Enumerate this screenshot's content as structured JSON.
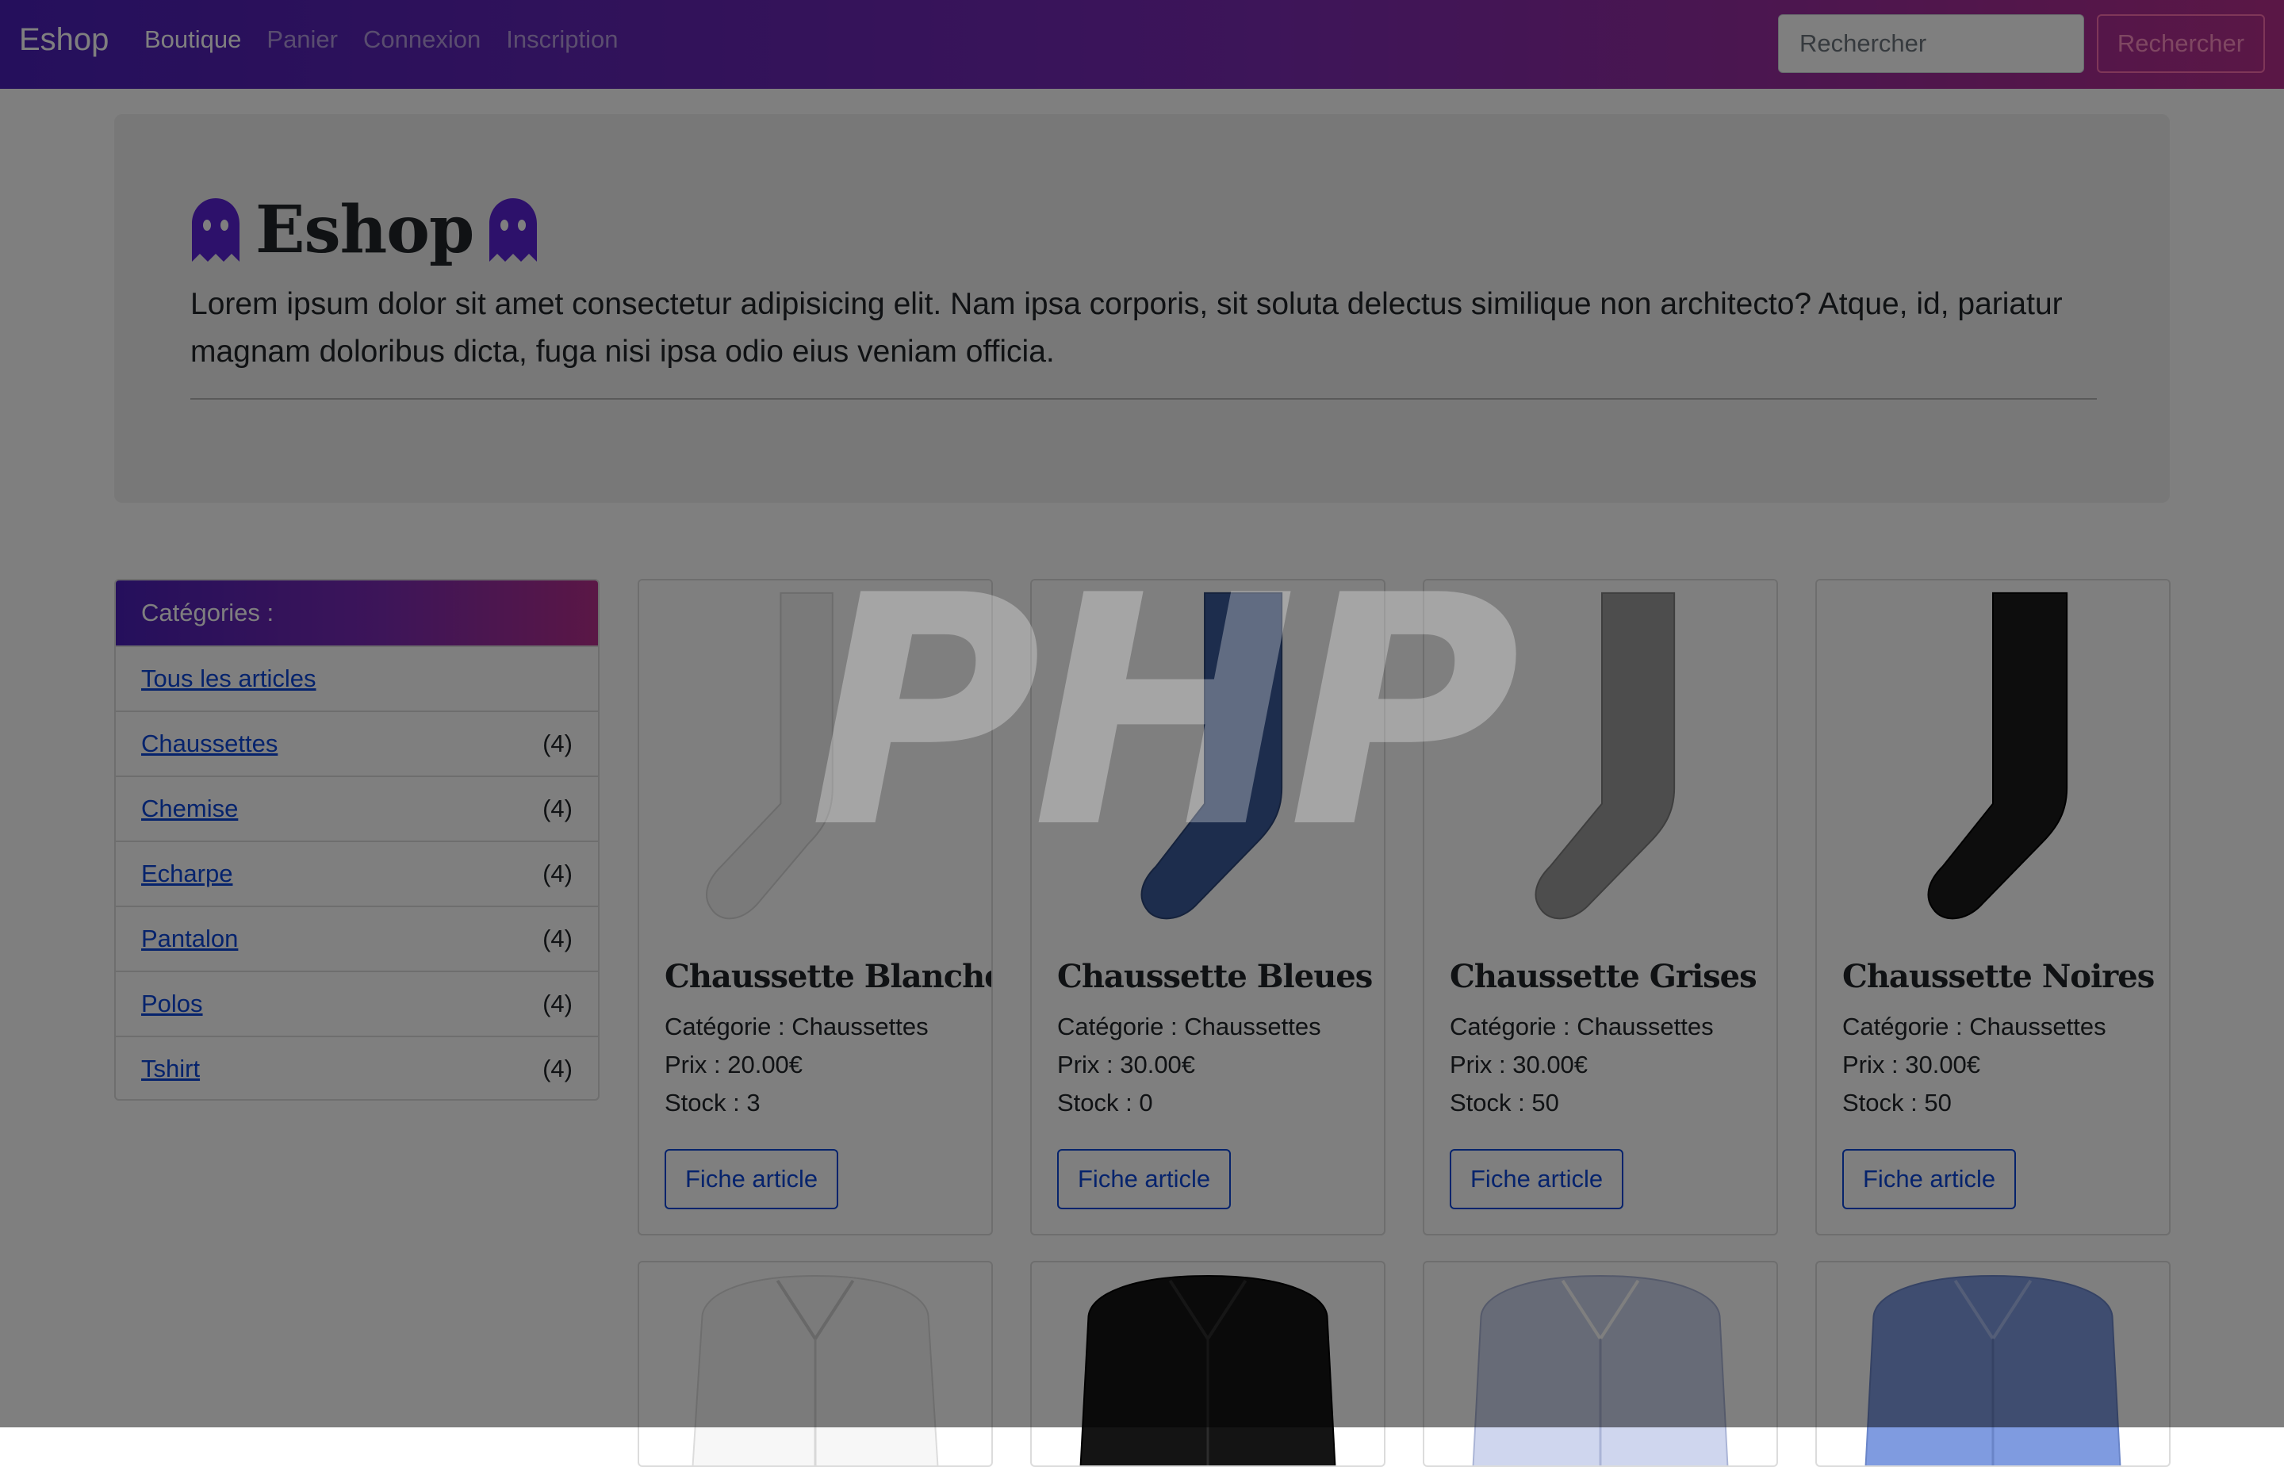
{
  "navbar": {
    "brand": "Eshop",
    "links": [
      "Boutique",
      "Panier",
      "Connexion",
      "Inscription"
    ],
    "search_placeholder": "Rechercher",
    "search_button": "Rechercher"
  },
  "hero": {
    "title": "Eshop",
    "description": "Lorem ipsum dolor sit amet consectetur adipisicing elit. Nam ipsa corporis, sit soluta delectus similique non architecto? Atque, id, pariatur magnam doloribus dicta, fuga nisi ipsa odio eius veniam officia."
  },
  "sidebar": {
    "header": "Catégories :",
    "all_label": "Tous les articles",
    "items": [
      {
        "label": "Chaussettes",
        "count": "(4)"
      },
      {
        "label": "Chemise",
        "count": "(4)"
      },
      {
        "label": "Echarpe",
        "count": "(4)"
      },
      {
        "label": "Pantalon",
        "count": "(4)"
      },
      {
        "label": "Polos",
        "count": "(4)"
      },
      {
        "label": "Tshirt",
        "count": "(4)"
      }
    ]
  },
  "products": [
    {
      "name": "Chaussette Blanches",
      "category": "Catégorie : Chaussettes",
      "price": "Prix : 20.00€",
      "stock": "Stock : 3",
      "button": "Fiche article",
      "image_color": "#f4f4f4"
    },
    {
      "name": "Chaussette Bleues",
      "category": "Catégorie : Chaussettes",
      "price": "Prix : 30.00€",
      "stock": "Stock : 0",
      "button": "Fiche article",
      "image_color": "#3b5a9a"
    },
    {
      "name": "Chaussette Grises",
      "category": "Catégorie : Chaussettes",
      "price": "Prix : 30.00€",
      "stock": "Stock : 50",
      "button": "Fiche article",
      "image_color": "#9a9a9a"
    },
    {
      "name": "Chaussette Noires",
      "category": "Catégorie : Chaussettes",
      "price": "Prix : 30.00€",
      "stock": "Stock : 50",
      "button": "Fiche article",
      "image_color": "#1a1a1a"
    }
  ],
  "shirts": [
    {
      "image_color": "#f7f7f7"
    },
    {
      "image_color": "#141414"
    },
    {
      "image_color": "#cfd6ee"
    },
    {
      "image_color": "#7f9be0"
    }
  ],
  "watermark": "PHP",
  "colors": {
    "nav_gradient_start": "#4a1fb8",
    "nav_gradient_end": "#b52e8c",
    "link_blue": "#0d47d9",
    "ghost_purple": "#5a22d6"
  },
  "icons": [
    "ghost-icon"
  ]
}
